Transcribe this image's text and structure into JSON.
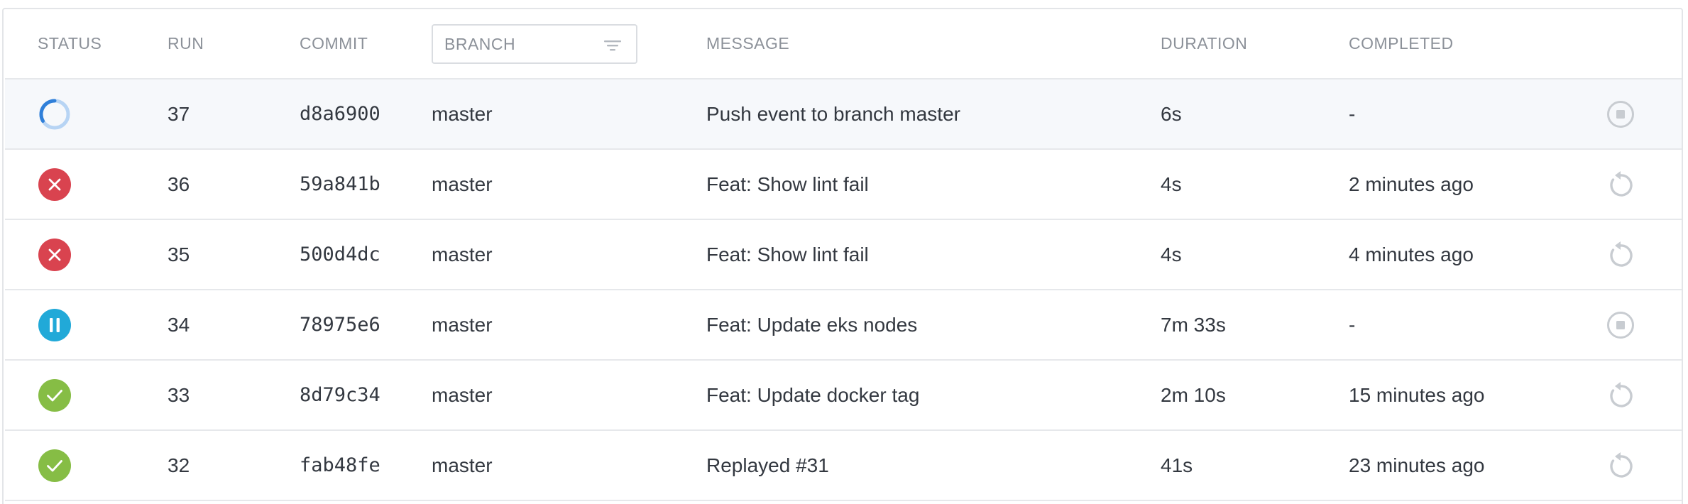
{
  "header": {
    "status": "STATUS",
    "run": "RUN",
    "commit": "COMMIT",
    "branch": "BRANCH",
    "message": "MESSAGE",
    "duration": "DURATION",
    "completed": "COMPLETED"
  },
  "colors": {
    "failed": "#d9434f",
    "paused": "#21a9d8",
    "success": "#86bd45",
    "running_dark": "#2f7fd9",
    "running_light": "#b7d4f4",
    "action_icon": "#c8ccd1"
  },
  "runs": [
    {
      "status": "running",
      "status_icon": "spinner-icon",
      "run": "37",
      "commit": "d8a6900",
      "branch": "master",
      "message": "Push event to branch master",
      "duration": "6s",
      "completed": "-",
      "action": "stop-icon"
    },
    {
      "status": "failed",
      "status_icon": "x-circle-icon",
      "run": "36",
      "commit": "59a841b",
      "branch": "master",
      "message": "Feat: Show lint fail",
      "duration": "4s",
      "completed": "2 minutes ago",
      "action": "restart-icon"
    },
    {
      "status": "failed",
      "status_icon": "x-circle-icon",
      "run": "35",
      "commit": "500d4dc",
      "branch": "master",
      "message": "Feat: Show lint fail",
      "duration": "4s",
      "completed": "4 minutes ago",
      "action": "restart-icon"
    },
    {
      "status": "paused",
      "status_icon": "pause-circle-icon",
      "run": "34",
      "commit": "78975e6",
      "branch": "master",
      "message": "Feat: Update eks nodes",
      "duration": "7m 33s",
      "completed": "-",
      "action": "stop-icon"
    },
    {
      "status": "success",
      "status_icon": "check-circle-icon",
      "run": "33",
      "commit": "8d79c34",
      "branch": "master",
      "message": "Feat: Update docker tag",
      "duration": "2m 10s",
      "completed": "15 minutes ago",
      "action": "restart-icon"
    },
    {
      "status": "success",
      "status_icon": "check-circle-icon",
      "run": "32",
      "commit": "fab48fe",
      "branch": "master",
      "message": "Replayed #31",
      "duration": "41s",
      "completed": "23 minutes ago",
      "action": "restart-icon"
    }
  ]
}
